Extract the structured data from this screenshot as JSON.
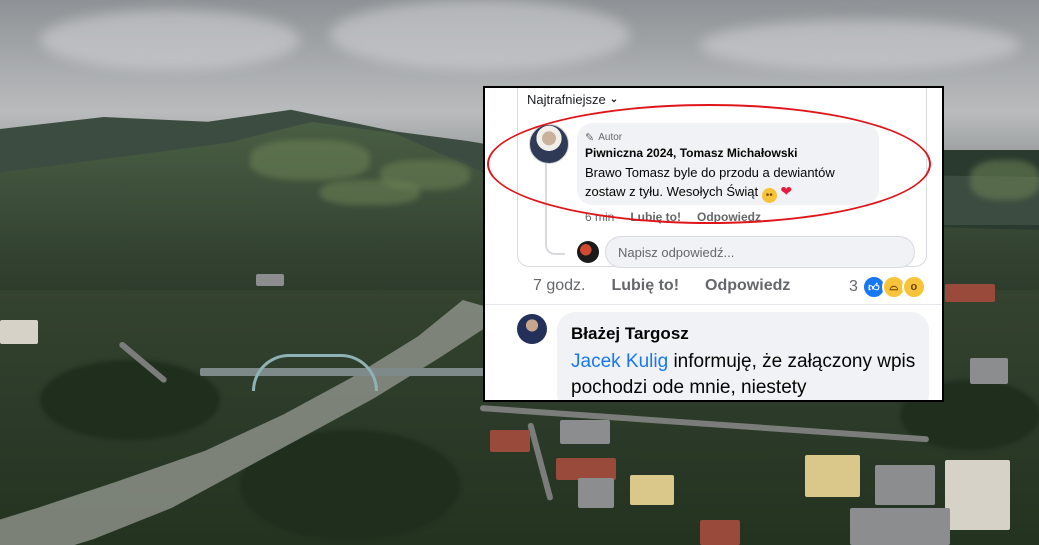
{
  "facebook": {
    "sort_label": "Najtrafniejsze",
    "nested_reply": {
      "badge": "Autor",
      "author": "Piwniczna 2024, Tomasz Michałowski",
      "text": "Brawo Tomasz byle do przodu a dewiantów zostaw z tyłu. Wesołych Świąt",
      "time": "6 min",
      "like": "Lubię to!",
      "reply": "Odpowiedz"
    },
    "reply_input": {
      "placeholder": "Napisz odpowiedź..."
    },
    "parent_comment": {
      "time": "7 godz.",
      "like": "Lubię to!",
      "reply": "Odpowiedz",
      "reaction_count": "3"
    },
    "next_comment": {
      "author": "Błażej Targosz",
      "mention": "Jacek Kulig",
      "text": " informuję, że załączony wpis pochodzi ode mnie, niestety"
    }
  },
  "colors": {
    "highlight": "#e0151b",
    "link": "#1877f2",
    "bubble": "#f0f2f5"
  },
  "icons": [
    "pencil-icon",
    "chevron-down-icon",
    "smile-emoji",
    "heart-emoji",
    "like-reaction-icon",
    "haha-reaction-icon",
    "wow-reaction-icon"
  ]
}
